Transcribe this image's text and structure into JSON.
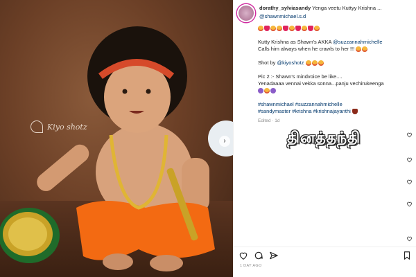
{
  "post": {
    "username": "dorathy_sylviasandy",
    "title": "Yenga veetu Kuttyy Krishna ...",
    "mention_top": "@shawnmichael.s.d",
    "caption_line1": "Kutty Krishna as Shawn's AKKA",
    "caption_mention": "@suzzannahmichelle",
    "caption_line2": "Calls him always when he crawls to her !!!",
    "shot_by_label": "Shot by",
    "shot_by_mention": "@kiyoshotz",
    "pic2_line": "Pic 2 :- Shawn's mindvoice be like....",
    "pic2_tamil": "Yenadaaaa vennai vekka sonna...panju vechirukeenga",
    "hashtags_line1": "#shawnmichael #suzzannahmichelle",
    "hashtags_line2": "#sandymaster #krishna #krishnajayanthi",
    "edited": "Edited · 1d",
    "date": "1 DAY AGO"
  },
  "photo": {
    "watermark": "Kiyo shotz"
  },
  "site_mark": "தினத்தந்தி",
  "icons": {
    "like": "heart-icon",
    "comment": "comment-icon",
    "share": "send-icon",
    "save": "bookmark-icon",
    "next": "chevron-right-icon"
  },
  "colors": {
    "link": "#00376b",
    "muted": "#8e8e8e",
    "text": "#262626"
  }
}
